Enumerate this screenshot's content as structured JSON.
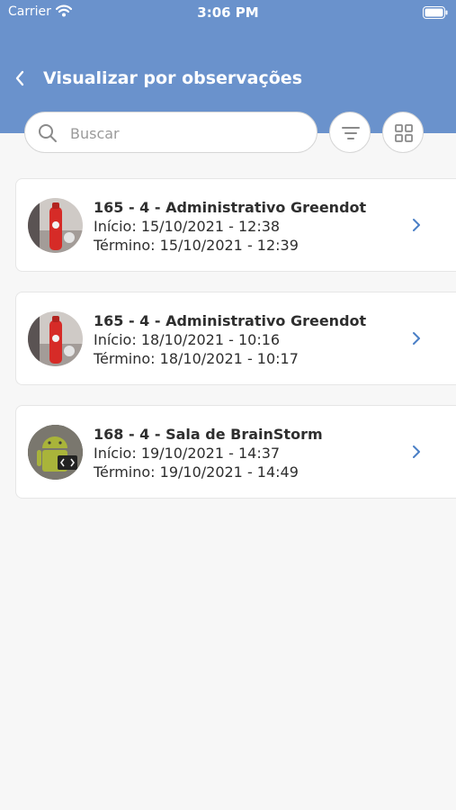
{
  "status_bar": {
    "carrier": "Carrier",
    "time": "3:06 PM"
  },
  "header": {
    "title": "Visualizar por observações"
  },
  "search": {
    "placeholder": "Buscar",
    "value": ""
  },
  "colors": {
    "header_bg": "#6a92cc",
    "accent": "#4a7fc6",
    "text": "#2e2e2e"
  },
  "observations": [
    {
      "title": "165 - 4 - Administrativo Greendot",
      "start": "Início: 15/10/2021 - 12:38",
      "end": "Término: 15/10/2021 - 12:39",
      "thumbnail": "red-bottle-photo"
    },
    {
      "title": "165 - 4 - Administrativo Greendot",
      "start": "Início: 18/10/2021 - 10:16",
      "end": "Término: 18/10/2021 - 10:17",
      "thumbnail": "red-bottle-photo"
    },
    {
      "title": "168 - 4 - Sala de BrainStorm",
      "start": "Início: 19/10/2021 - 14:37",
      "end": "Término: 19/10/2021 - 14:49",
      "thumbnail": "android-robot-photo"
    }
  ]
}
